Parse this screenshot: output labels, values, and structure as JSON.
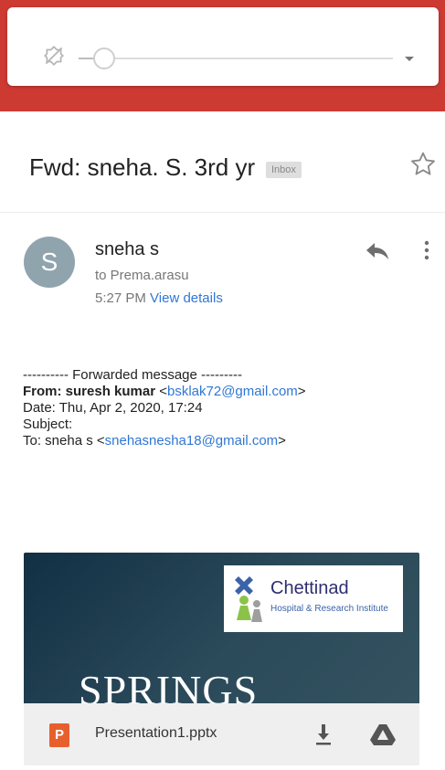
{
  "brightness": {
    "level": 0.08,
    "icon": "brightness-auto-off-icon",
    "toggle_icon": "chevron-down-icon"
  },
  "colors": {
    "header_red": "#cc3a32",
    "link_blue": "#2f77d4",
    "avatar": "#90a4ae",
    "ppt_orange": "#e85f2e"
  },
  "email": {
    "subject": "Fwd: sneha. S. 3rd yr",
    "label": "Inbox",
    "avatar_letter": "S",
    "sender": "sneha s",
    "recipient": "to Prema.arasu",
    "time": "5:27 PM",
    "view_details": "View details",
    "forwarded": {
      "header": "---------- Forwarded message ---------",
      "from_label": "From: ",
      "from_name": "suresh kumar",
      "from_email": "bsklak72@gmail.com",
      "date": "Date: Thu, Apr 2, 2020, 17:24",
      "subject": "Subject:",
      "to_label": "To: sneha s <",
      "to_email": "snehasnesha18@gmail.com"
    }
  },
  "attachment": {
    "logo_main": "Chettinad",
    "logo_sub": "Hospital & Research Institute",
    "preview_title": "SPRINGS",
    "file_type": "P",
    "filename": "Presentation1.pptx"
  }
}
